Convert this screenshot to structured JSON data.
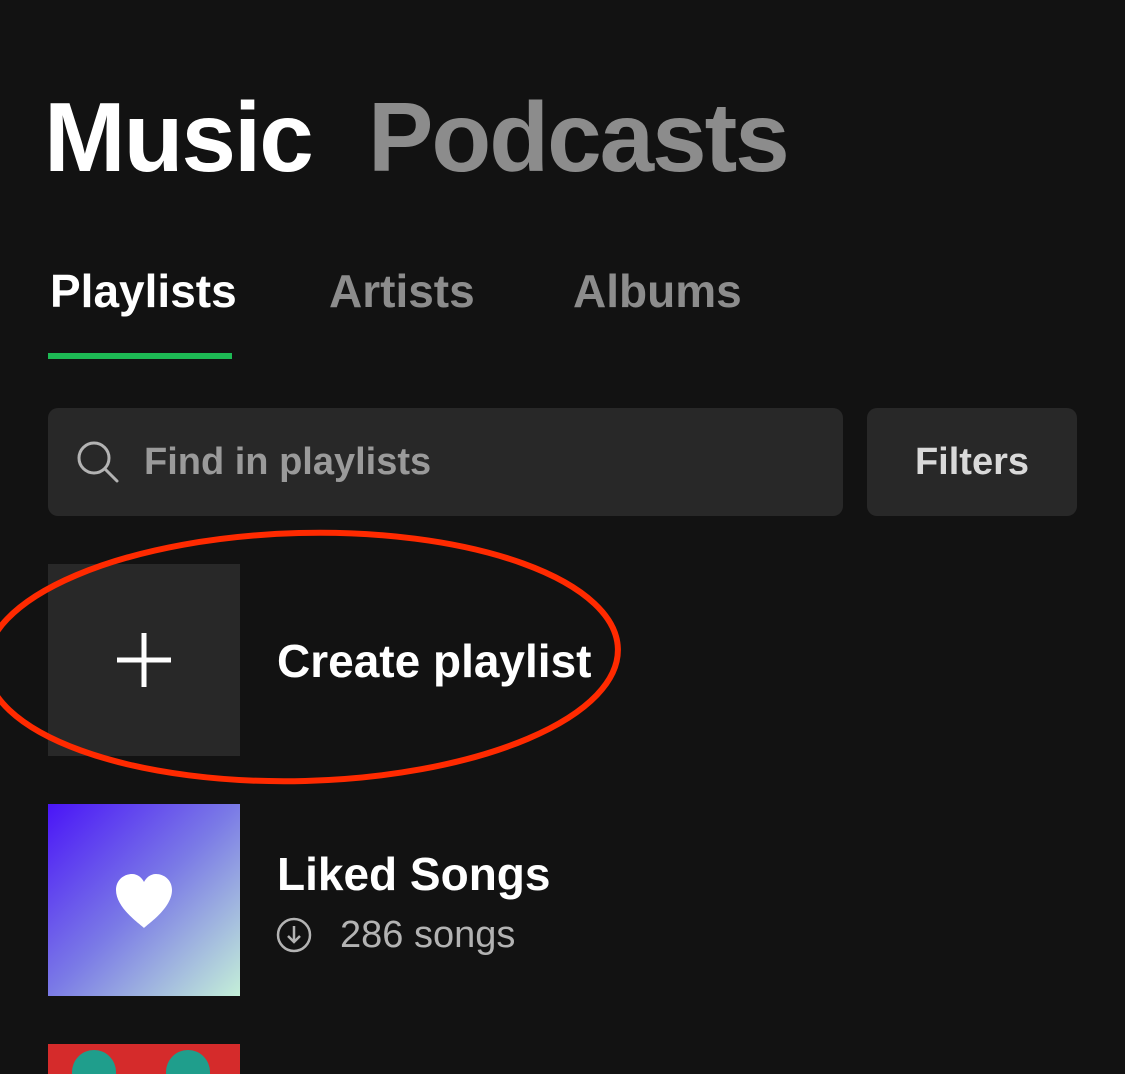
{
  "header": {
    "tabs": [
      {
        "label": "Music",
        "active": true
      },
      {
        "label": "Podcasts",
        "active": false
      }
    ]
  },
  "subtabs": [
    {
      "label": "Playlists",
      "active": true
    },
    {
      "label": "Artists",
      "active": false
    },
    {
      "label": "Albums",
      "active": false
    }
  ],
  "search": {
    "placeholder": "Find in playlists",
    "value": ""
  },
  "filters": {
    "label": "Filters"
  },
  "list": {
    "create": {
      "title": "Create playlist",
      "icon": "plus-icon"
    },
    "liked": {
      "title": "Liked Songs",
      "subtitle": "286 songs",
      "status_icon": "download-icon"
    }
  },
  "colors": {
    "background": "#121212",
    "accent": "#1db954",
    "annotation": "#ff2a00"
  }
}
